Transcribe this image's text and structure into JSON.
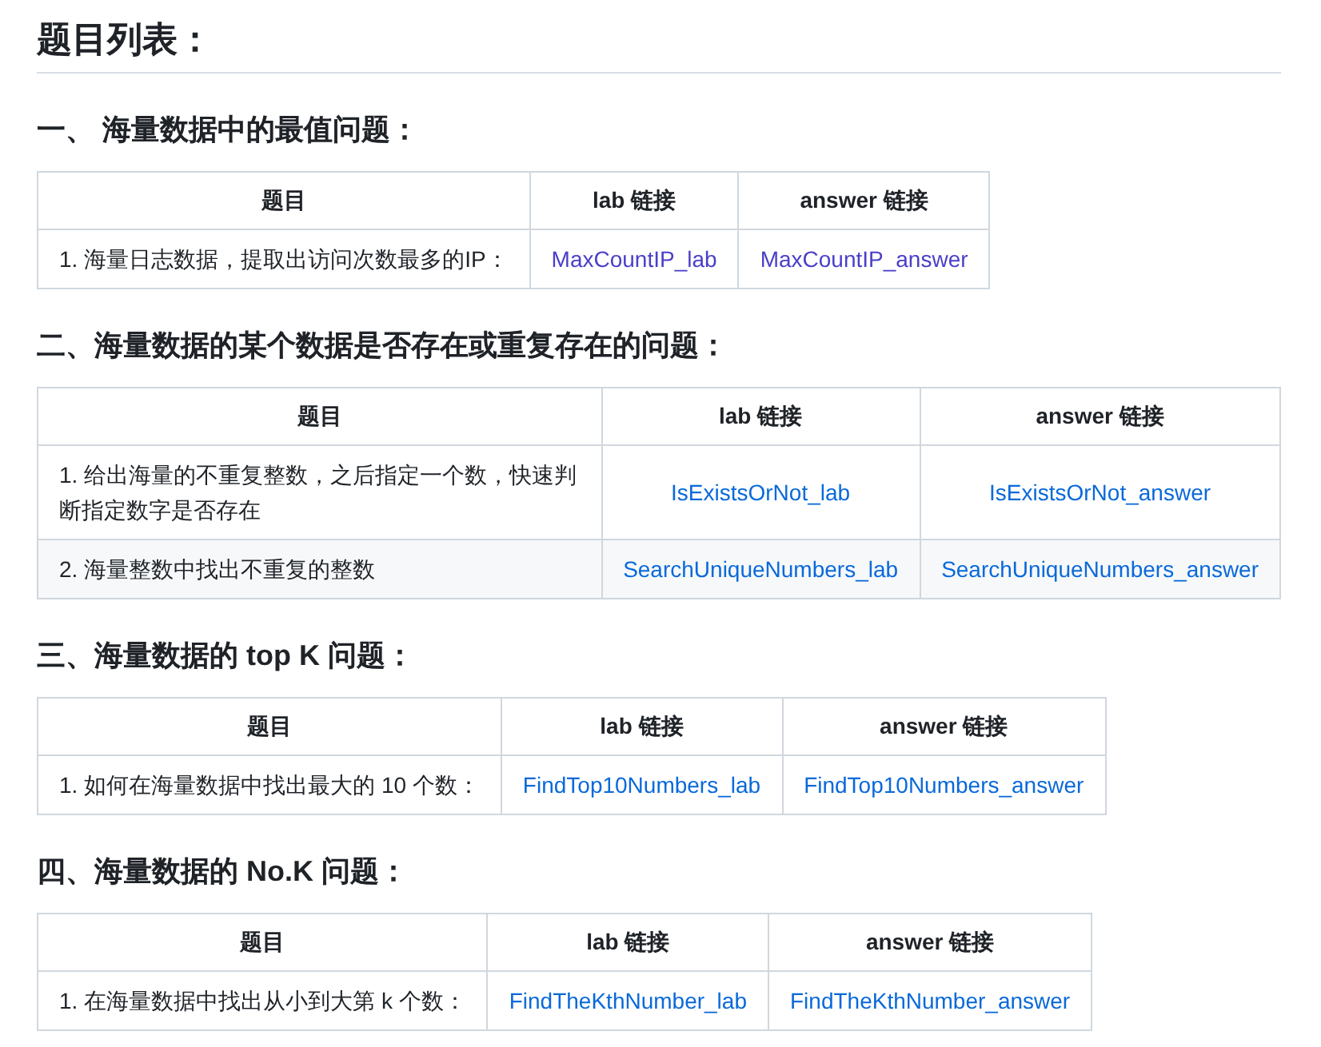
{
  "title": "题目列表：",
  "sections": [
    {
      "heading": "一、 海量数据中的最值问题：",
      "columns": [
        "题目",
        "lab 链接",
        "answer 链接"
      ],
      "rows": [
        {
          "question": "1. 海量日志数据，提取出访问次数最多的IP：",
          "lab": "MaxCountIP_lab",
          "answer": "MaxCountIP_answer"
        }
      ]
    },
    {
      "heading": "二、海量数据的某个数据是否存在或重复存在的问题：",
      "columns": [
        "题目",
        "lab 链接",
        "answer 链接"
      ],
      "rows": [
        {
          "question": "1. 给出海量的不重复整数，之后指定一个数，快速判断指定数字是否存在",
          "lab": "IsExistsOrNot_lab",
          "answer": "IsExistsOrNot_answer"
        },
        {
          "question": "2. 海量整数中找出不重复的整数",
          "lab": "SearchUniqueNumbers_lab",
          "answer": "SearchUniqueNumbers_answer"
        }
      ]
    },
    {
      "heading": "三、海量数据的 top K 问题：",
      "columns": [
        "题目",
        "lab 链接",
        "answer 链接"
      ],
      "rows": [
        {
          "question": "1. 如何在海量数据中找出最大的 10 个数：",
          "lab": "FindTop10Numbers_lab",
          "answer": "FindTop10Numbers_answer"
        }
      ]
    },
    {
      "heading": "四、海量数据的 No.K 问题：",
      "columns": [
        "题目",
        "lab 链接",
        "answer 链接"
      ],
      "rows": [
        {
          "question": "1. 在海量数据中找出从小到大第 k 个数：",
          "lab": "FindTheKthNumber_lab",
          "answer": "FindTheKthNumber_answer"
        }
      ]
    }
  ]
}
